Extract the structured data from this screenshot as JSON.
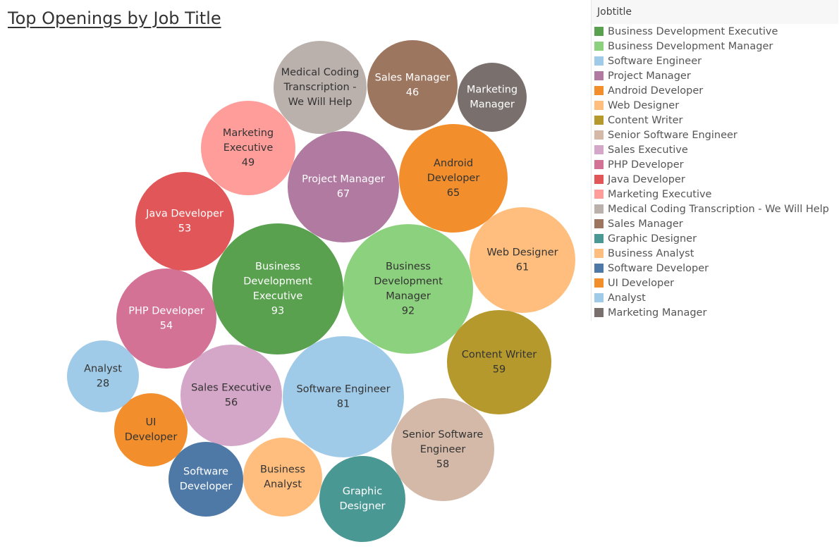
{
  "chart_data": {
    "type": "bubble",
    "title": "Top Openings by Job Title",
    "legend": {
      "title": "Jobtitle",
      "position": "right"
    },
    "series": [
      {
        "name": "Business Development Executive",
        "value": 93,
        "color": "#59a14f",
        "label_lines": [
          "Business",
          "Development",
          "Executive",
          "93"
        ],
        "text_color": "#ffffff"
      },
      {
        "name": "Business Development Manager",
        "value": 92,
        "color": "#8cd17d",
        "label_lines": [
          "Business",
          "Development",
          "Manager",
          "92"
        ],
        "text_color": "#333333"
      },
      {
        "name": "Software Engineer",
        "value": 81,
        "color": "#a0cbe8",
        "label_lines": [
          "Software Engineer",
          "81"
        ],
        "text_color": "#333333"
      },
      {
        "name": "Project Manager",
        "value": 67,
        "color": "#b07aa1",
        "label_lines": [
          "Project Manager",
          "67"
        ],
        "text_color": "#ffffff"
      },
      {
        "name": "Android Developer",
        "value": 65,
        "color": "#f28e2b",
        "label_lines": [
          "Android",
          "Developer",
          "65"
        ],
        "text_color": "#333333"
      },
      {
        "name": "Web Designer",
        "value": 61,
        "color": "#ffbe7d",
        "label_lines": [
          "Web Designer",
          "61"
        ],
        "text_color": "#333333"
      },
      {
        "name": "Content Writer",
        "value": 59,
        "color": "#b6992d",
        "label_lines": [
          "Content Writer",
          "59"
        ],
        "text_color": "#333333"
      },
      {
        "name": "Senior Software Engineer",
        "value": 58,
        "color": "#d4b9a8",
        "label_lines": [
          "Senior Software",
          "Engineer",
          "58"
        ],
        "text_color": "#333333"
      },
      {
        "name": "Sales Executive",
        "value": 56,
        "color": "#d4a6c8",
        "label_lines": [
          "Sales Executive",
          "56"
        ],
        "text_color": "#333333"
      },
      {
        "name": "PHP Developer",
        "value": 54,
        "color": "#d37295",
        "label_lines": [
          "PHP Developer",
          "54"
        ],
        "text_color": "#ffffff"
      },
      {
        "name": "Java Developer",
        "value": 53,
        "color": "#e15759",
        "label_lines": [
          "Java Developer",
          "53"
        ],
        "text_color": "#ffffff"
      },
      {
        "name": "Marketing Executive",
        "value": 49,
        "color": "#ff9d9a",
        "label_lines": [
          "Marketing",
          "Executive",
          "49"
        ],
        "text_color": "#333333"
      },
      {
        "name": "Medical Coding Transcription - We Will Help",
        "value": null,
        "color": "#bab0ac",
        "label_lines": [
          "Medical Coding",
          "Transcription -",
          "We Will Help"
        ],
        "text_color": "#333333"
      },
      {
        "name": "Sales Manager",
        "value": 46,
        "color": "#9d7660",
        "label_lines": [
          "Sales Manager",
          "46"
        ],
        "text_color": "#ffffff"
      },
      {
        "name": "Graphic Designer",
        "value": null,
        "color": "#499894",
        "label_lines": [
          "Graphic",
          "Designer"
        ],
        "text_color": "#ffffff"
      },
      {
        "name": "Business Analyst",
        "value": null,
        "color": "#ffbe7d",
        "label_lines": [
          "Business",
          "Analyst"
        ],
        "text_color": "#333333"
      },
      {
        "name": "Software Developer",
        "value": null,
        "color": "#4e79a7",
        "label_lines": [
          "Software",
          "Developer"
        ],
        "text_color": "#ffffff"
      },
      {
        "name": "UI Developer",
        "value": null,
        "color": "#f28e2b",
        "label_lines": [
          "UI",
          "Developer"
        ],
        "text_color": "#333333"
      },
      {
        "name": "Analyst",
        "value": 28,
        "color": "#a0cbe8",
        "label_lines": [
          "Analyst",
          "28"
        ],
        "text_color": "#333333"
      },
      {
        "name": "Marketing Manager",
        "value": null,
        "color": "#79706e",
        "label_lines": [
          "Marketing",
          "Manager"
        ],
        "text_color": "#ffffff"
      }
    ]
  }
}
